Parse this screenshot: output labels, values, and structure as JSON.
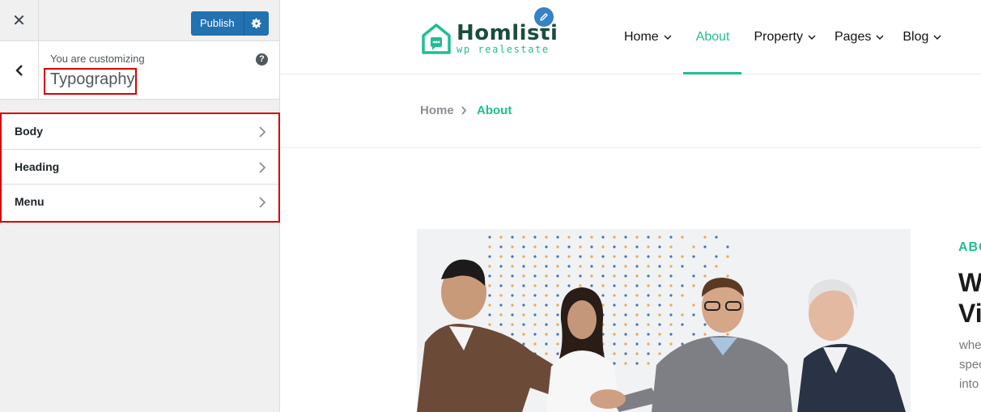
{
  "customizer": {
    "close_label": "✕",
    "publish_label": "Publish",
    "customizing_label": "You are customizing",
    "section_title": "Typography",
    "help_label": "?",
    "panels": [
      {
        "label": "Body"
      },
      {
        "label": "Heading"
      },
      {
        "label": "Menu"
      }
    ]
  },
  "site": {
    "logo_name": "Homlisti",
    "logo_tagline": "wp realestate",
    "nav": [
      {
        "label": "Home",
        "has_dropdown": true
      },
      {
        "label": "About",
        "has_dropdown": false,
        "active": true
      },
      {
        "label": "Property",
        "has_dropdown": true
      },
      {
        "label": "Pages",
        "has_dropdown": true
      },
      {
        "label": "Blog",
        "has_dropdown": true
      }
    ],
    "breadcrumb": {
      "home": "Home",
      "current": "About"
    },
    "about": {
      "kicker": "ABO",
      "heading_lines": [
        "W",
        "Vi"
      ],
      "text_lines": [
        "whe",
        "spec",
        "into"
      ]
    }
  },
  "colors": {
    "accent": "#1fbf92",
    "wp_blue": "#2271b1",
    "highlight_red": "#d80000",
    "logo_dark": "#1b4d3e"
  }
}
